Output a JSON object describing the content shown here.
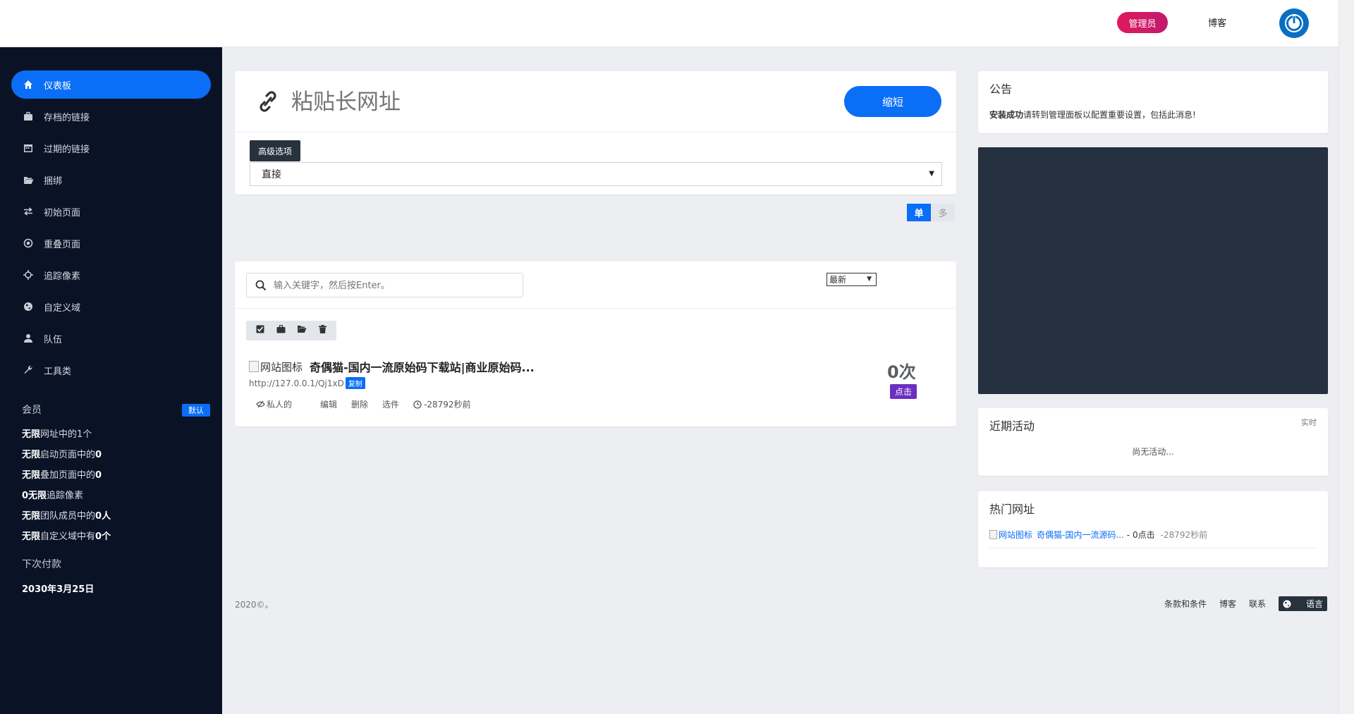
{
  "header": {
    "admin_label": "管理员",
    "blog_label": "博客",
    "power_icon": "power-icon",
    "accent": "#0a6ef7"
  },
  "sidebar": {
    "items": [
      {
        "label": "仪表板",
        "icon": "home-icon"
      },
      {
        "label": "存档的链接",
        "icon": "briefcase-icon"
      },
      {
        "label": "过期的链接",
        "icon": "calendar-icon"
      },
      {
        "label": "捆绑",
        "icon": "folder-open-icon"
      },
      {
        "label": "初始页面",
        "icon": "exchange-icon"
      },
      {
        "label": "重叠页面",
        "icon": "target-icon"
      },
      {
        "label": "追踪像素",
        "icon": "crosshair-icon"
      },
      {
        "label": "自定义域",
        "icon": "globe-icon"
      },
      {
        "label": "队伍",
        "icon": "user-icon"
      },
      {
        "label": "工具类",
        "icon": "wrench-icon"
      }
    ],
    "membership": {
      "title": "会员",
      "badge": "默认",
      "quotas": [
        {
          "bold": "无限",
          "rest": "网址中的1个",
          "bold2": ""
        },
        {
          "bold": "无限",
          "rest": "启动页面中的",
          "bold2": "0"
        },
        {
          "bold": "无限",
          "rest": "叠加页面中的",
          "bold2": "0"
        },
        {
          "bold": "0无限",
          "rest": "追踪像素",
          "bold2": ""
        },
        {
          "bold": "无限",
          "rest": "团队成员中的",
          "bold2": "0人"
        },
        {
          "bold": "无限",
          "rest": "自定义域中有",
          "bold2": "0个"
        }
      ],
      "next_payment_label": "下次付款",
      "next_payment_date": "2030年3月25日"
    }
  },
  "shortener": {
    "placeholder": "粘贴长网址",
    "shorten_label": "缩短",
    "advanced_label": "高级选项",
    "redirect_value": "直接",
    "mode_single": "单",
    "mode_multi": "多"
  },
  "links": {
    "search_placeholder": "输入关键字，然后按Enter。",
    "sort_value": "最新",
    "bulk_icons": [
      "check-square-icon",
      "briefcase-icon",
      "folder-open-icon",
      "trash-icon"
    ],
    "items": [
      {
        "img_alt": "网站图标",
        "title": "奇偶猫-国内一流原始码下载站|商业原始码...",
        "short_url": "http://127.0.0.1/Qj1xD",
        "copy_label": "复制",
        "privacy": "私人的",
        "edit": "编辑",
        "delete": "删除",
        "options": "选件",
        "time": "-28792秒前",
        "clicks": "0次",
        "clicks_label": "点击"
      }
    ]
  },
  "notice": {
    "title": "公告",
    "bold": "安装成功",
    "text": "请转到管理面板以配置重要设置，包括此消息!"
  },
  "activity": {
    "title": "近期活动",
    "realtime": "实时",
    "empty": "尚无活动..."
  },
  "hot": {
    "title": "热门网址",
    "img_alt": "网站图标",
    "name": "奇偶猫-国内一流源码...",
    "meta": "- 0点击",
    "time": "-28792秒前"
  },
  "footer": {
    "copyright": "2020©。",
    "terms": "条款和条件",
    "blog": "博客",
    "contact": "联系",
    "language": "语言"
  }
}
